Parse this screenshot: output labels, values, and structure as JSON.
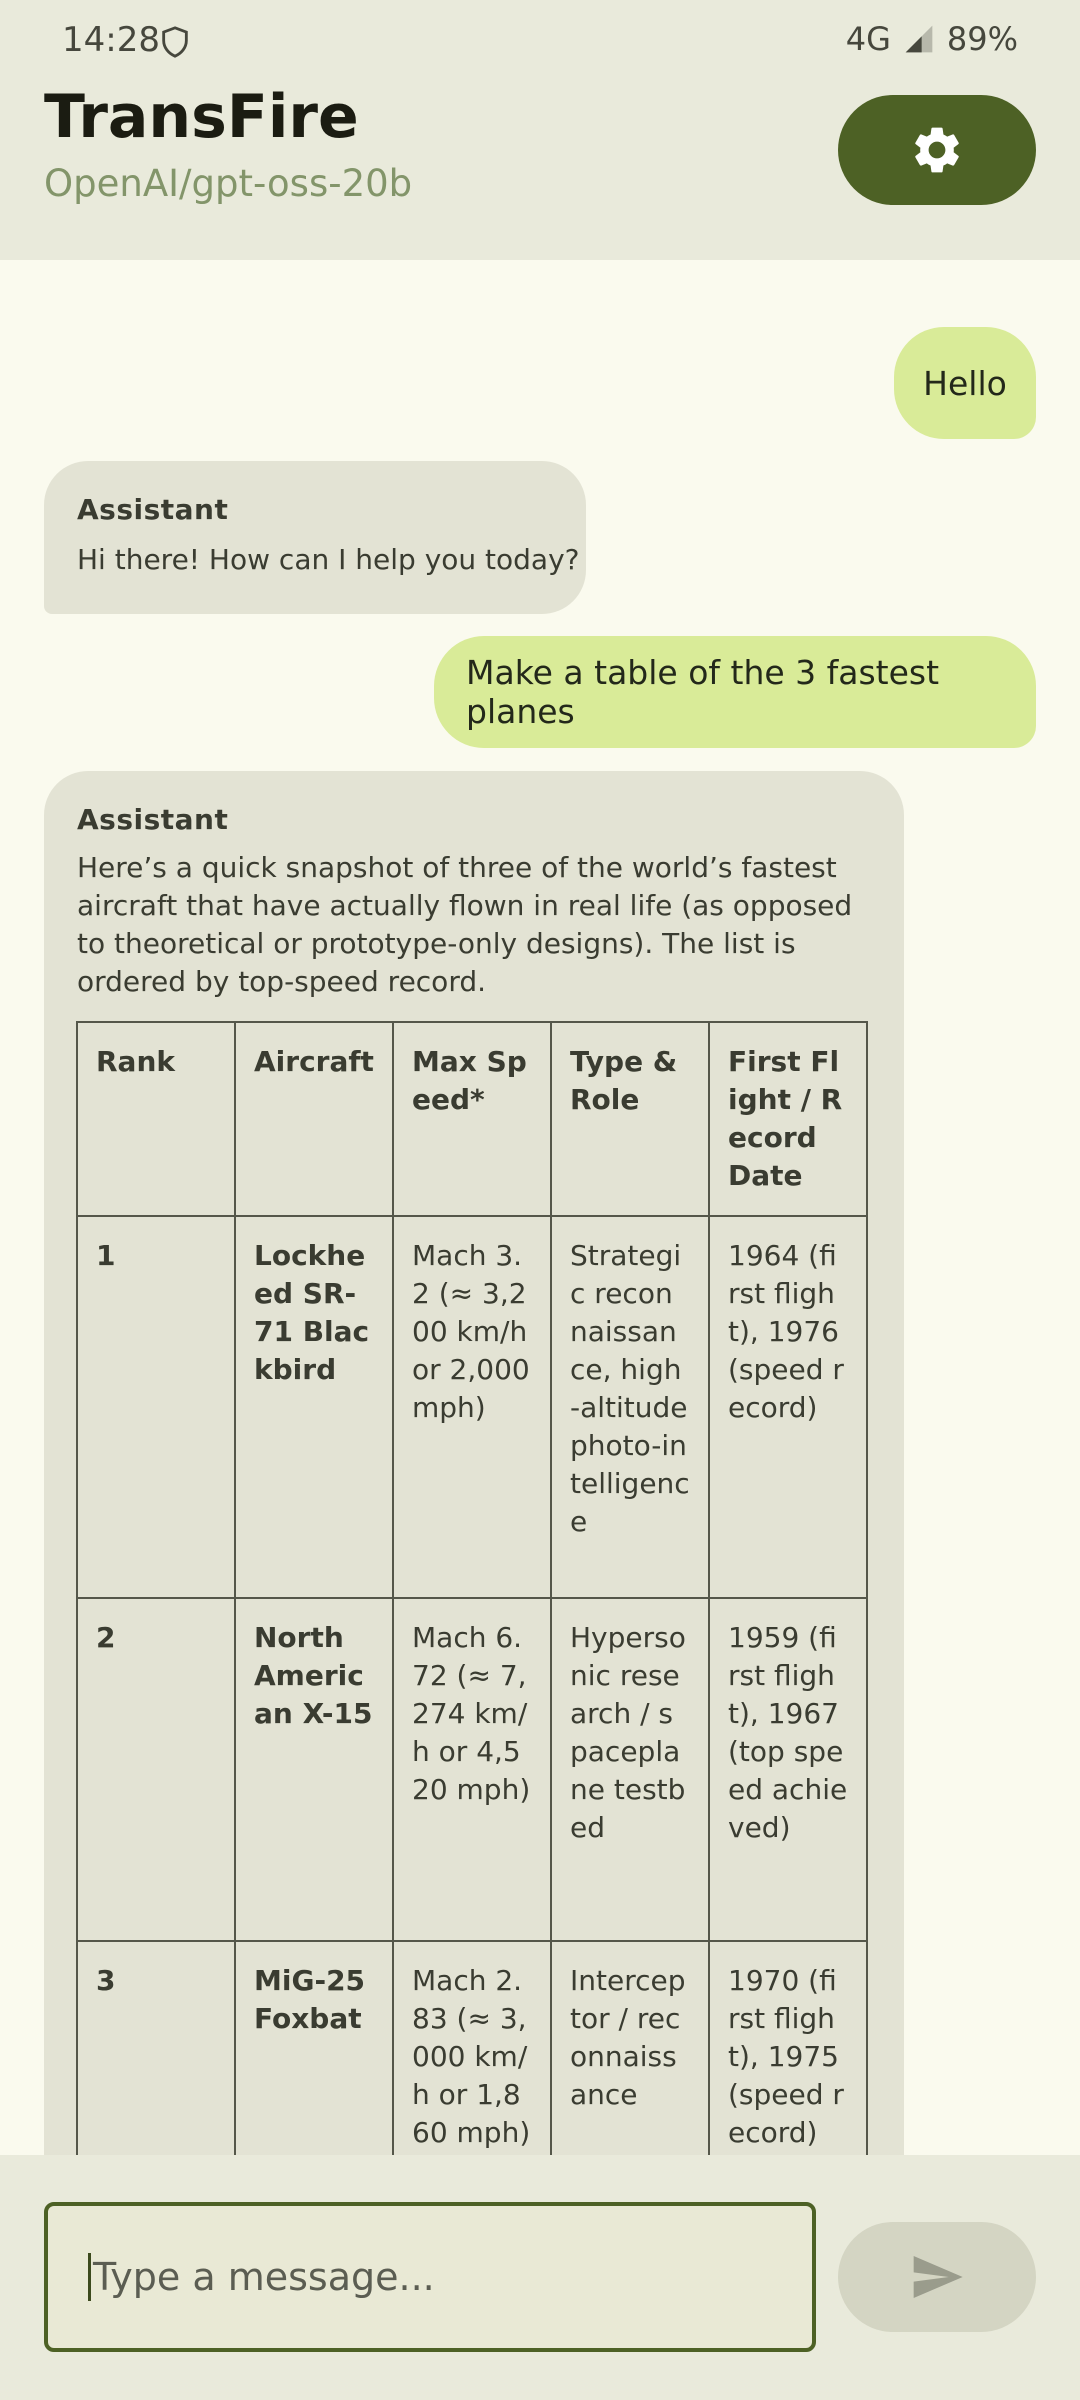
{
  "status": {
    "time": "14:28",
    "network": "4G",
    "battery": "89%"
  },
  "app": {
    "title": "TransFire",
    "model": "OpenAI/gpt-oss-20b"
  },
  "messages": [
    {
      "role": "user",
      "text": "Hello"
    },
    {
      "role": "assistant",
      "label": "Assistant",
      "text": "Hi there! How can I help you today?"
    },
    {
      "role": "user",
      "text": "Make a table of the 3 fastest planes"
    },
    {
      "role": "assistant",
      "label": "Assistant",
      "text": "Here’s a quick snapshot of three of the world’s fastest aircraft that have actually flown in real life (as opposed to theoretical or prototype-only designs).  The list is ordered by top-speed record.",
      "table": {
        "headers": [
          "Rank",
          "Aircraft",
          "Max Speed*",
          "Type & Role",
          "First Flight / Record Date"
        ],
        "rows": [
          [
            "1",
            "Lockheed SR-71 Blackbird",
            "Mach 3.2 (≈ 3,200 km/h or 2,000 mph)",
            "Strategic reconnaissance, high-altitude photo-intelligence",
            "1964 (first flight), 1976 (speed record)"
          ],
          [
            "2",
            "North American X-15",
            "Mach 6.72 (≈ 7,274 km/h or 4,520 mph)",
            "Hypersonic research / spaceplane testbed",
            "1959 (first flight), 1967 (top speed achieved)"
          ],
          [
            "3",
            "MiG-25 Foxbat",
            "Mach 2.83 (≈ 3,000 km/h or 1,860 mph)",
            "Interceptor / reconnaissance",
            "1970 (first flight), 1975 (speed record)"
          ]
        ]
      }
    }
  ],
  "composer": {
    "placeholder": "Type a message..."
  },
  "icons": {
    "settings": "gear-icon",
    "send": "send-icon",
    "shield": "shield-icon",
    "signal": "signal-icon"
  },
  "colors": {
    "accent": "#4d6125",
    "user_bubble": "#d9eb98",
    "assistant_bubble": "#e3e3d4"
  }
}
